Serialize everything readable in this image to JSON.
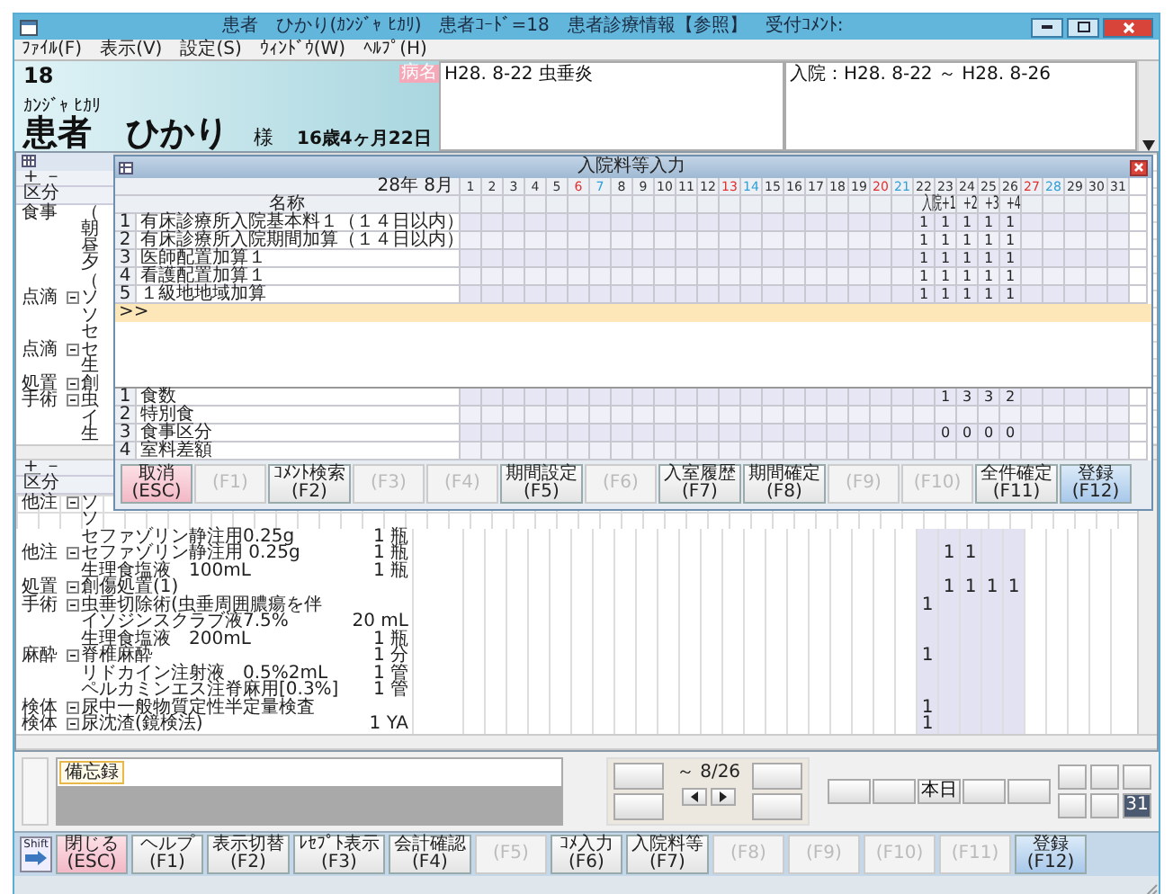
{
  "window": {
    "title": "患者　ひかり(ｶﾝｼﾞｬ ﾋｶﾘ)　患者ｺｰﾄﾞ=18　患者診療情報【参照】　受付ｺﾒﾝﾄ:"
  },
  "menu": [
    "ﾌｧｲﾙ(F)",
    "表示(V)",
    "設定(S)",
    "ｳｨﾝﾄﾞｳ(W)",
    "ﾍﾙﾌﾟ(H)"
  ],
  "patient": {
    "id": "18",
    "kana": "ｶﾝｼﾞｬ ﾋｶﾘ",
    "name": "患者　ひかり",
    "honorific": "様",
    "age": "16歳4ヶ月22日",
    "badge": "病名",
    "diagnosis": "H28. 8-22 虫垂炎",
    "admission": "入院：H28. 8-22 ～ H28. 8-26"
  },
  "order_list_top": {
    "toggle_label": "+ －",
    "column": "区分",
    "groups": [
      {
        "kind": "plain",
        "category": "食事",
        "name": "（",
        "children": [
          "朝",
          "昼",
          "夕",
          "（"
        ]
      },
      {
        "kind": "order",
        "category": "点滴",
        "expanded": true,
        "name": "ソ",
        "children": [
          "ソ",
          "セ"
        ]
      },
      {
        "kind": "order",
        "category": "点滴",
        "expanded": true,
        "name": "セ",
        "children": [
          "生"
        ]
      },
      {
        "kind": "order",
        "category": "処置",
        "expanded": true,
        "name": "創"
      },
      {
        "kind": "order",
        "category": "手術",
        "expanded": true,
        "name": "虫",
        "children": [
          "イ",
          "生"
        ]
      }
    ]
  },
  "order_list_bottom": {
    "toggle_label": "+ －",
    "column": "区分",
    "groups": [
      {
        "kind": "covered",
        "category": "他注",
        "expanded": true,
        "name": "ソ",
        "children": [
          {
            "kind": "covered",
            "name": "ソ"
          },
          {
            "kind": "full",
            "name": "セファゾリン静注用0.25g",
            "qty": "1 瓶"
          }
        ]
      },
      {
        "kind": "full",
        "category": "他注",
        "expanded": true,
        "name": "セファゾリン静注用 0.25g",
        "qty": "1 瓶",
        "marks": {
          "23": "1",
          "24": "1"
        },
        "children": [
          {
            "kind": "full",
            "name": "生理食塩液　100mL",
            "qty": "1 瓶"
          }
        ]
      },
      {
        "kind": "full",
        "category": "処置",
        "expanded": true,
        "name": "創傷処置(1)",
        "marks": {
          "23": "1",
          "24": "1",
          "25": "1",
          "26": "1"
        }
      },
      {
        "kind": "full",
        "category": "手術",
        "expanded": true,
        "name": "虫垂切除術(虫垂周囲膿瘍を伴",
        "marks": {
          "22": "1"
        },
        "children": [
          {
            "kind": "full",
            "name": "イソジンスクラブ液7.5%",
            "qty": "20 mL"
          },
          {
            "kind": "full",
            "name": "生理食塩液　200mL",
            "qty": "1 瓶"
          }
        ]
      },
      {
        "kind": "full",
        "category": "麻酔",
        "expanded": true,
        "name": "脊椎麻酔",
        "qty": "1 分",
        "marks": {
          "22": "1"
        },
        "children": [
          {
            "kind": "full",
            "name": "リドカイン注射液　0.5%2mL",
            "qty": "1 管"
          },
          {
            "kind": "full",
            "name": "ペルカミンエス注脊麻用[0.3%]",
            "qty": "1 管"
          }
        ]
      },
      {
        "kind": "full",
        "category": "検体",
        "expanded": true,
        "name": "尿中一般物質定性半定量検査",
        "marks": {
          "22": "1"
        }
      },
      {
        "kind": "full",
        "category": "検体",
        "expanded": true,
        "name": "尿沈渣(鏡検法)",
        "qty": "1 YA",
        "marks": {
          "22": "1"
        }
      }
    ]
  },
  "dialog": {
    "title": "入院料等入力",
    "year_month": "28年 8月",
    "name_header": "名称",
    "days": [
      {
        "label": "1",
        "kind": "weekday"
      },
      {
        "label": "2",
        "kind": "weekday"
      },
      {
        "label": "3",
        "kind": "weekday"
      },
      {
        "label": "4",
        "kind": "weekday"
      },
      {
        "label": "5",
        "kind": "weekday"
      },
      {
        "label": "6",
        "kind": "saturday"
      },
      {
        "label": "7",
        "kind": "sunday"
      },
      {
        "label": "8",
        "kind": "weekday"
      },
      {
        "label": "9",
        "kind": "weekday"
      },
      {
        "label": "10",
        "kind": "weekday"
      },
      {
        "label": "11",
        "kind": "weekday"
      },
      {
        "label": "12",
        "kind": "weekday"
      },
      {
        "label": "13",
        "kind": "saturday"
      },
      {
        "label": "14",
        "kind": "sunday"
      },
      {
        "label": "15",
        "kind": "weekday"
      },
      {
        "label": "16",
        "kind": "weekday"
      },
      {
        "label": "17",
        "kind": "weekday"
      },
      {
        "label": "18",
        "kind": "weekday"
      },
      {
        "label": "19",
        "kind": "weekday"
      },
      {
        "label": "20",
        "kind": "saturday"
      },
      {
        "label": "21",
        "kind": "sunday"
      },
      {
        "label": "22",
        "kind": "weekday"
      },
      {
        "label": "23",
        "kind": "weekday"
      },
      {
        "label": "24",
        "kind": "weekday"
      },
      {
        "label": "25",
        "kind": "weekday"
      },
      {
        "label": "26",
        "kind": "weekday"
      },
      {
        "label": "27",
        "kind": "saturday"
      },
      {
        "label": "28",
        "kind": "sunday"
      },
      {
        "label": "29",
        "kind": "weekday"
      },
      {
        "label": "30",
        "kind": "weekday"
      },
      {
        "label": "31",
        "kind": "weekday"
      }
    ],
    "stay_labels": {
      "22": "入院",
      "23": "+1",
      "24": "+2",
      "25": "+3",
      "26": "+4"
    },
    "rows": [
      {
        "no": "1",
        "name": "有床診療所入院基本料１（１４日以内）",
        "marks": {
          "22": "1",
          "23": "1",
          "24": "1",
          "25": "1",
          "26": "1"
        }
      },
      {
        "no": "2",
        "name": "有床診療所入院期間加算（１４日以内）",
        "marks": {
          "22": "1",
          "23": "1",
          "24": "1",
          "25": "1",
          "26": "1"
        }
      },
      {
        "no": "3",
        "name": "医師配置加算１",
        "marks": {
          "22": "1",
          "23": "1",
          "24": "1",
          "25": "1",
          "26": "1"
        }
      },
      {
        "no": "4",
        "name": "看護配置加算１",
        "marks": {
          "22": "1",
          "23": "1",
          "24": "1",
          "25": "1",
          "26": "1"
        }
      },
      {
        "no": "5",
        "name": "１級地地域加算",
        "marks": {
          "22": "1",
          "23": "1",
          "24": "1",
          "25": "1",
          "26": "1"
        }
      }
    ],
    "entry_prompt": ">>",
    "meal_rows": [
      {
        "no": "1",
        "name": "食数",
        "marks": {
          "23": "1",
          "24": "3",
          "25": "3",
          "26": "2"
        }
      },
      {
        "no": "2",
        "name": "特別食"
      },
      {
        "no": "3",
        "name": "食事区分",
        "marks": {
          "23": "0",
          "24": "0",
          "25": "0",
          "26": "0"
        }
      },
      {
        "no": "4",
        "name": "室料差額"
      }
    ],
    "buttons": [
      {
        "label": "取消",
        "key": "(ESC)",
        "kind": "cancel",
        "disabled": false
      },
      {
        "key": "(F1)",
        "kind": "normal",
        "disabled": true
      },
      {
        "label": "ｺﾒﾝﾄ検索",
        "key": "(F2)",
        "kind": "normal",
        "disabled": false
      },
      {
        "key": "(F3)",
        "kind": "normal",
        "disabled": true
      },
      {
        "key": "(F4)",
        "kind": "normal",
        "disabled": true
      },
      {
        "label": "期間設定",
        "key": "(F5)",
        "kind": "normal",
        "disabled": false
      },
      {
        "key": "(F6)",
        "kind": "normal",
        "disabled": true
      },
      {
        "label": "入室履歴",
        "key": "(F7)",
        "kind": "normal",
        "disabled": false
      },
      {
        "label": "期間確定",
        "key": "(F8)",
        "kind": "normal",
        "disabled": false
      },
      {
        "key": "(F9)",
        "kind": "normal",
        "disabled": true
      },
      {
        "key": "(F10)",
        "kind": "normal",
        "disabled": true
      },
      {
        "label": "全件確定",
        "key": "(F11)",
        "kind": "normal",
        "disabled": false
      },
      {
        "label": "登録",
        "key": "(F12)",
        "kind": "register",
        "disabled": false
      }
    ]
  },
  "memo": {
    "tab": "備忘録"
  },
  "date_nav": {
    "range": "～ 8/26",
    "today": "本日",
    "calendar_day": "31"
  },
  "function_keys": {
    "shift_label": "Shift",
    "buttons": [
      {
        "label": "閉じる",
        "key": "(ESC)",
        "kind": "cancel",
        "disabled": false
      },
      {
        "label": "ヘルプ",
        "key": "(F1)",
        "kind": "normal",
        "disabled": false
      },
      {
        "label": "表示切替",
        "key": "(F2)",
        "kind": "normal",
        "disabled": false
      },
      {
        "label": "ﾚｾﾌﾟﾄ表示",
        "key": "(F3)",
        "kind": "normal",
        "disabled": false
      },
      {
        "label": "会計確認",
        "key": "(F4)",
        "kind": "normal",
        "disabled": false
      },
      {
        "key": "(F5)",
        "kind": "normal",
        "disabled": true
      },
      {
        "label": "ｺﾒ入力",
        "key": "(F6)",
        "kind": "normal",
        "disabled": false
      },
      {
        "label": "入院料等",
        "key": "(F7)",
        "kind": "normal",
        "disabled": false
      },
      {
        "key": "(F8)",
        "kind": "normal",
        "disabled": true
      },
      {
        "key": "(F9)",
        "kind": "normal",
        "disabled": true
      },
      {
        "key": "(F10)",
        "kind": "normal",
        "disabled": true
      },
      {
        "key": "(F11)",
        "kind": "normal",
        "disabled": true
      },
      {
        "label": "登録",
        "key": "(F12)",
        "kind": "register",
        "disabled": false
      }
    ]
  }
}
